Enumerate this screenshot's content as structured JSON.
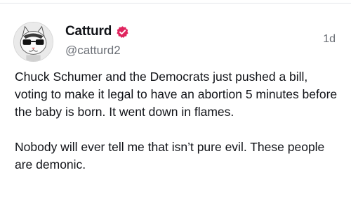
{
  "post": {
    "author": {
      "display_name": "Catturd",
      "handle": "@catturd2",
      "verified": true,
      "avatar_icon": "cat-with-glasses-avatar"
    },
    "timestamp": "1d",
    "paragraphs": [
      "Chuck Schumer and the Democrats just pushed a bill, voting to make it legal to have an abortion 5 minutes before the baby is born. It went down in flames.",
      "Nobody will ever tell me that isn’t pure evil. These people are demonic."
    ]
  },
  "colors": {
    "text": "#111318",
    "muted": "#6b6f76",
    "verified_badge": "#e0245e",
    "background": "#ffffff"
  }
}
